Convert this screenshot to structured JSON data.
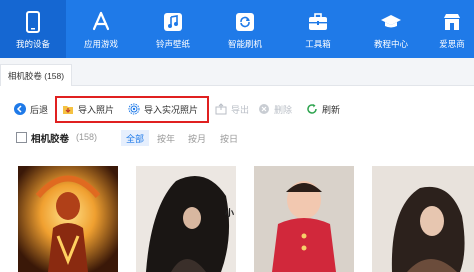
{
  "nav": {
    "items": [
      {
        "label": "我的设备",
        "icon": "phone-icon"
      },
      {
        "label": "应用游戏",
        "icon": "app-store-icon"
      },
      {
        "label": "铃声壁纸",
        "icon": "music-icon"
      },
      {
        "label": "智能刷机",
        "icon": "refresh-icon"
      },
      {
        "label": "工具箱",
        "icon": "toolbox-icon"
      },
      {
        "label": "教程中心",
        "icon": "graduation-cap-icon"
      },
      {
        "label": "爱思商",
        "icon": "store-icon"
      }
    ],
    "active_color": "#1567d2",
    "bg_color": "#1f7ae8"
  },
  "tab": {
    "label": "相机胶卷 (158)"
  },
  "toolbar": {
    "back": "后退",
    "import_photos": "导入照片",
    "import_live": "导入实况照片",
    "export": "导出",
    "delete": "删除",
    "refresh": "刷新"
  },
  "filter": {
    "title": "相机胶卷",
    "count": "(158)",
    "options": [
      "全部",
      "按年",
      "按月",
      "按日"
    ],
    "active_index": 0
  },
  "gallery": {
    "overlay_text": "小"
  },
  "colors": {
    "highlight": "#e02020",
    "accent": "#1f7ae8"
  }
}
